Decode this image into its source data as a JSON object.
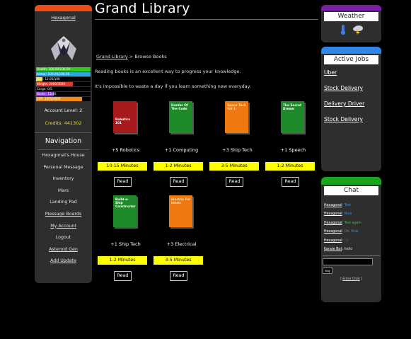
{
  "colors": {
    "left_cap": "#f04c18",
    "weather_cap": "#7a1fa8",
    "jobs_cap": "#2f86e8",
    "chat_cap": "#19a51f",
    "time_badge": "#ffff00",
    "credits": "#e8d82a"
  },
  "sidebar": {
    "username": "Hexagonal",
    "stats": [
      {
        "label": "Health: 100.00/100.00",
        "fraction": 1.0,
        "color": "#2ecc1e"
      },
      {
        "label": "Armor: 100.00/100.00",
        "fraction": 1.0,
        "color": "#29a8e0"
      },
      {
        "label": "Fuel: 12.05/100",
        "fraction": 0.12,
        "color": "#e8d82a"
      },
      {
        "label": "Weight: 2000/3000",
        "fraction": 0.67,
        "color": "#e03a2a"
      },
      {
        "label": "Cargo: 0/5",
        "fraction": 0.0,
        "color": "#888888"
      },
      {
        "label": "Books: 13/40",
        "fraction": 0.33,
        "color": "#8f3ad6"
      },
      {
        "label": "EXP: 3405/4000",
        "fraction": 0.85,
        "color": "#f08a18"
      }
    ],
    "account_level": "Account Level: 2",
    "credits": "Credits: 441302",
    "nav_title": "Navigation",
    "nav": [
      {
        "label": "Hexagonal's House",
        "link": false
      },
      {
        "label": "Personal Message",
        "link": false
      },
      {
        "label": "Inventory",
        "link": false
      },
      {
        "label": "Mars",
        "link": false
      },
      {
        "label": "Landing Pad",
        "link": false
      },
      {
        "label": "Message Boards",
        "link": true
      },
      {
        "label": "My Account",
        "link": true
      },
      {
        "label": "Logout",
        "link": false
      },
      {
        "label": "Asteroid Gen",
        "link": true
      },
      {
        "label": "Add Update",
        "link": true
      }
    ]
  },
  "main": {
    "title": "Grand Library",
    "breadcrumb": {
      "link": "Grand Library",
      "current": " > Browse Books"
    },
    "intro1": "Reading books is an excellent way to progress your knowledge.",
    "intro2": "It's impossible to waste a day if you learn something new everyday.",
    "read_label": "Read",
    "books": [
      {
        "cover_text": "Robotics 101",
        "color": "#a8191b",
        "bonus": "+5 Robotics",
        "time": "10-15 Minutes"
      },
      {
        "cover_text": "Harder Of The Code",
        "color": "#1f8a2a",
        "bonus": "+1 Computing",
        "time": "1-2 Minutes"
      },
      {
        "cover_text": "Space Tech Vol 1",
        "color": "#f0780f",
        "bonus": "+3 Ship Tech",
        "time": "3-5 Minutes"
      },
      {
        "cover_text": "The Secret Dream",
        "color": "#1f8a2a",
        "bonus": "+1 Speech",
        "time": "1-2 Minutes"
      },
      {
        "cover_text": "Build-a-Ship Constructor",
        "color": "#1f8a2a",
        "bonus": "+1 Ship Tech",
        "time": "1-2 Minutes"
      },
      {
        "cover_text": "Electric For Idiots",
        "color": "#f0780f",
        "bonus": "+3 Electrical",
        "time": "3-5 Minutes"
      }
    ]
  },
  "weather": {
    "title": "Weather",
    "icons": [
      "thermometer-icon",
      "storm-cloud-icon"
    ]
  },
  "jobs": {
    "title": "Active Jobs",
    "items": [
      "Uber",
      "Stock Delivery",
      "Delivery Driver",
      "Stock Delivery"
    ]
  },
  "chat": {
    "title": "Chat",
    "messages": [
      {
        "who": "Hexagonal",
        "text": ": Test",
        "tone": "blue"
      },
      {
        "who": "Hexagonal",
        "text": ": Nice",
        "tone": "blue"
      },
      {
        "who": "Hexagonal",
        "text": ": Test again",
        "tone": "green"
      },
      {
        "who": "Hexagonal",
        "text": ": Ok, final",
        "tone": "blue"
      },
      {
        "who": "Hexagonal",
        "text": ": :-)",
        "tone": "blue"
      },
      {
        "who": "Karate Bot",
        "text": ": hello",
        "tone": "white"
      }
    ],
    "say_label": "Say",
    "enter_prefix": "[ ",
    "enter_link": "Enter Chat",
    "enter_suffix": " ]"
  }
}
